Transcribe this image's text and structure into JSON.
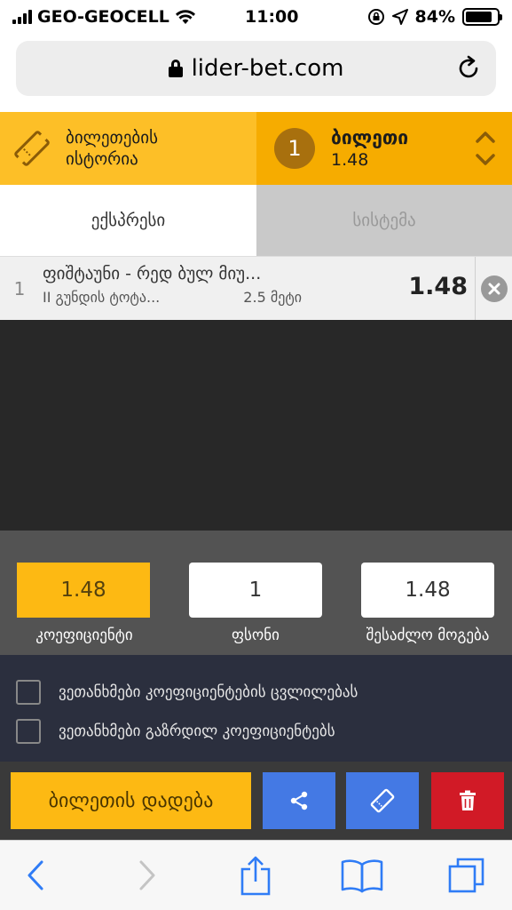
{
  "status_bar": {
    "carrier": "GEO-GEOCELL",
    "time": "11:00",
    "battery": "84%",
    "battery_level": 0.84
  },
  "browser": {
    "url": "lider-bet.com"
  },
  "header": {
    "history_label_line1": "ბილეთების",
    "history_label_line2": "ისტორია",
    "ticket_count": "1",
    "ticket_title": "ბილეთი",
    "ticket_odds": "1.48"
  },
  "tabs": [
    {
      "label": "ექსპრესი",
      "active": true
    },
    {
      "label": "სისტემა",
      "active": false
    }
  ],
  "bet": {
    "index": "1",
    "event": "ფიშტაუნი - რედ ბულ მიუ...",
    "market": "II გუნდის ტოტა...",
    "pick": "2.5 მეტი",
    "odds": "1.48"
  },
  "stakes": {
    "coefficient_value": "1.48",
    "stake_value": "1",
    "payout_value": "1.48",
    "coefficient_label": "კოეფიციენტი",
    "stake_label": "ფსონი",
    "payout_label": "შესაძლო მოგება"
  },
  "options": [
    {
      "label": "ვეთანხმები კოეფიციენტების ცვლილებას",
      "checked": false
    },
    {
      "label": "ვეთანხმები გაზრდილ კოეფიციენტებს",
      "checked": false
    }
  ],
  "actions": {
    "place_label": "ბილეთის დადება"
  },
  "colors": {
    "accent": "#fdb913",
    "ticket_bg": "#f6ac00",
    "blue": "#4479e4",
    "red": "#d11a26",
    "ios_blue": "#2f7cf6"
  }
}
